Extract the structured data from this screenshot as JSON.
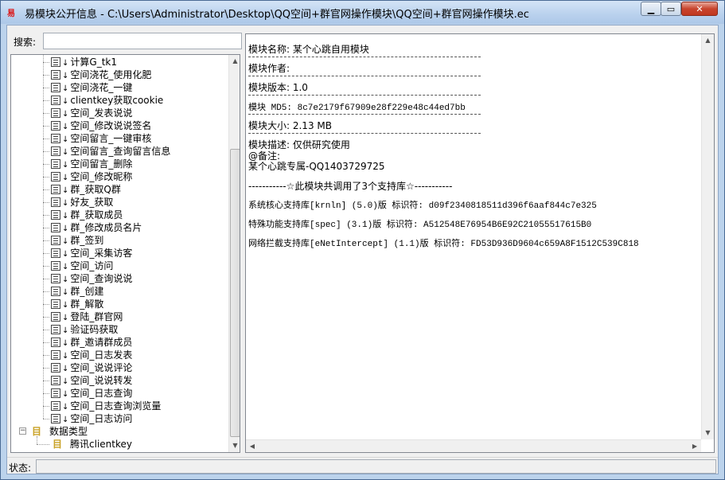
{
  "window": {
    "icon_text": "易",
    "title": "易模块公开信息 - C:\\Users\\Administrator\\Desktop\\QQ空间+群官网操作模块\\QQ空间+群官网操作模块.ec",
    "min_label": "▁",
    "max_label": "▭",
    "close_label": "✕"
  },
  "search": {
    "label": "搜索:",
    "value": ""
  },
  "tree": {
    "commands": [
      "计算G_tk1",
      "空间浇花_使用化肥",
      "空间浇花_一键",
      "clientkey获取cookie",
      "空间_发表说说",
      "空间_修改说说签名",
      "空间留言_一键审核",
      "空间留言_查询留言信息",
      "空间留言_删除",
      "空间_修改昵称",
      "群_获取Q群",
      "好友_获取",
      "群_获取成员",
      "群_修改成员名片",
      "群_签到",
      "空间_采集访客",
      "空间_访问",
      "空间_查询说说",
      "群_创建",
      "群_解散",
      "登陆_群官网",
      "验证码获取",
      "群_邀请群成员",
      "空间_日志发表",
      "空间_说说评论",
      "空间_说说转发",
      "空间_日志查询",
      "空间_日志查询浏览量",
      "空间_日志访问"
    ],
    "datatype_folder": "数据类型",
    "datatype_folder_icon": "目",
    "datatype_items": [
      "腾讯clientkey"
    ]
  },
  "info": {
    "name": "模块名称: 某个心跳自用模块",
    "author": "模块作者:",
    "version": "模块版本: 1.0",
    "md5": "模块 MD5: 8c7e2179f67909e28f229e48c44ed7bb",
    "size": "模块大小: 2.13 MB",
    "desc": "模块描述: 仅供研究使用",
    "note1": "@备注:",
    "note2": "某个心跳专属-QQ1403729725",
    "support_header": "-----------☆此模块共调用了3个支持库☆-----------",
    "libs": [
      "系统核心支持库[krnln] (5.0)版 标识符: d09f2340818511d396f6aaf844c7e325",
      "特殊功能支持库[spec] (3.1)版 标识符: A512548E76954B6E92C21055517615B0",
      "网络拦截支持库[eNetIntercept] (1.1)版 标识符: FD53D936D9604c659A8F1512C539C818"
    ]
  },
  "status": {
    "label": "状态:",
    "value": ""
  }
}
